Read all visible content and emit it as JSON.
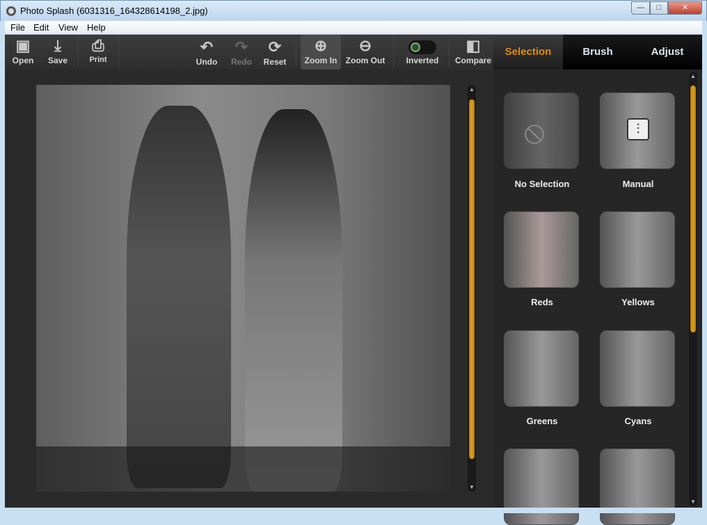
{
  "window": {
    "title": "Photo Splash (6031316_164328614198_2.jpg)",
    "minimize": "—",
    "maximize": "□",
    "close": "✕"
  },
  "menu": [
    "File",
    "Edit",
    "View",
    "Help"
  ],
  "toolbar": {
    "open": "Open",
    "save": "Save",
    "print": "Print",
    "undo": "Undo",
    "redo": "Redo",
    "reset": "Reset",
    "zoom_in": "Zoom In",
    "zoom_out": "Zoom Out",
    "inverted": "Inverted",
    "compare": "Compare"
  },
  "tabs": {
    "selection": "Selection",
    "brush": "Brush",
    "adjust": "Adjust",
    "active": "Selection"
  },
  "presets": [
    "No Selection",
    "Manual",
    "Reds",
    "Yellows",
    "Greens",
    "Cyans"
  ],
  "colors": {
    "accent": "#e08a10",
    "scroll_thumb": "#e0a020"
  }
}
